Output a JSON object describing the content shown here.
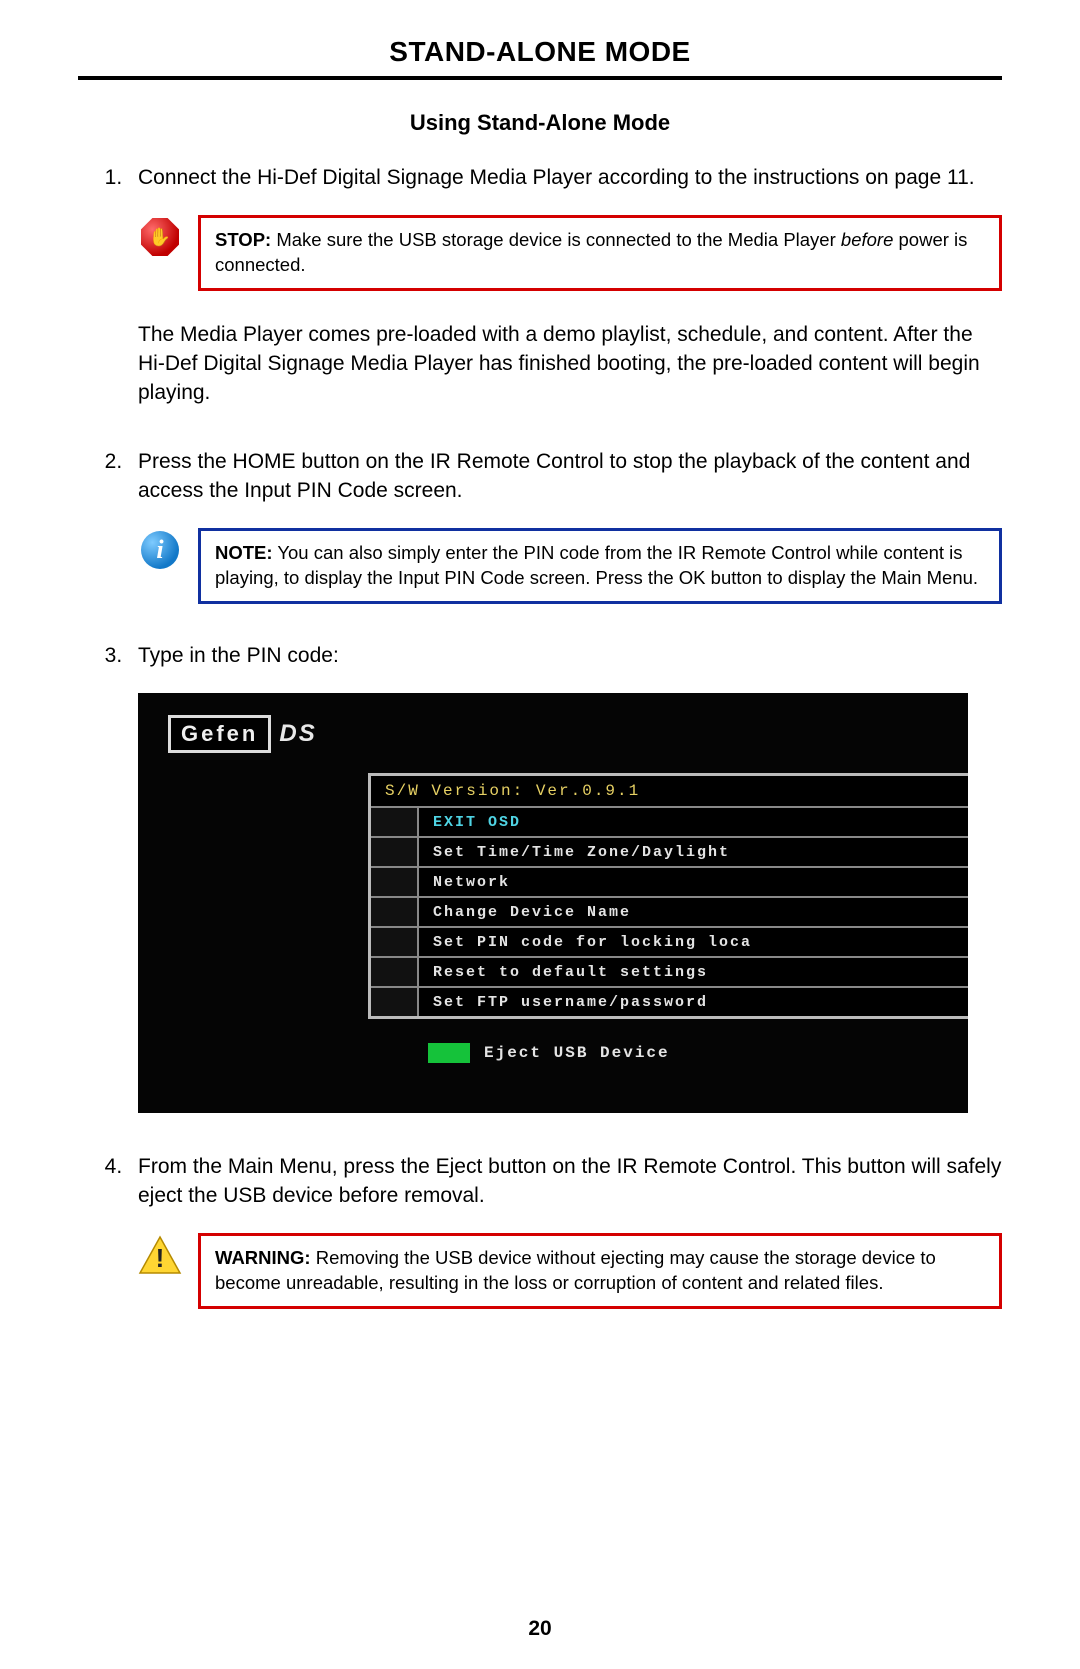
{
  "header": {
    "title": "STAND-ALONE MODE"
  },
  "section": {
    "title": "Using Stand-Alone Mode"
  },
  "steps": {
    "s1": "Connect the Hi-Def Digital Signage Media Player according to the instructions on page 11.",
    "s1_para": "The Media Player comes pre-loaded with a demo playlist, schedule, and content.  After the Hi-Def Digital Signage Media Player has finished booting, the pre-loaded content will begin playing.",
    "s2": "Press the HOME button on the IR Remote Control to stop the playback of the content and access the Input PIN Code screen.",
    "s3": "Type in the PIN code:",
    "s4": "From the Main Menu, press the Eject button on the IR Remote Control.  This button will safely eject the USB device before removal."
  },
  "callouts": {
    "stop": {
      "label": "STOP:",
      "text_a": " Make sure the USB storage device is connected to the Media Player ",
      "italic": "before",
      "text_b": " power is connected."
    },
    "note": {
      "label": "NOTE:",
      "text": " You can also simply enter the PIN code from the IR Remote Control while content is playing, to display the Input PIN Code screen.  Press the OK button to display the Main Menu."
    },
    "warning": {
      "label": "WARNING:",
      "text": " Removing the USB device without ejecting may cause the storage device to become unreadable, resulting in the loss or corruption of content and related files."
    }
  },
  "osd": {
    "logo_main": "Gefen",
    "logo_sub": "DS",
    "version": "S/W Version: Ver.0.9.1",
    "menu": [
      "EXIT OSD",
      "Set Time/Time Zone/Daylight",
      "Network",
      "Change Device Name",
      "Set PIN code for locking loca",
      "Reset to default settings",
      "Set FTP username/password"
    ],
    "eject": "Eject USB Device"
  },
  "page_number": "20"
}
